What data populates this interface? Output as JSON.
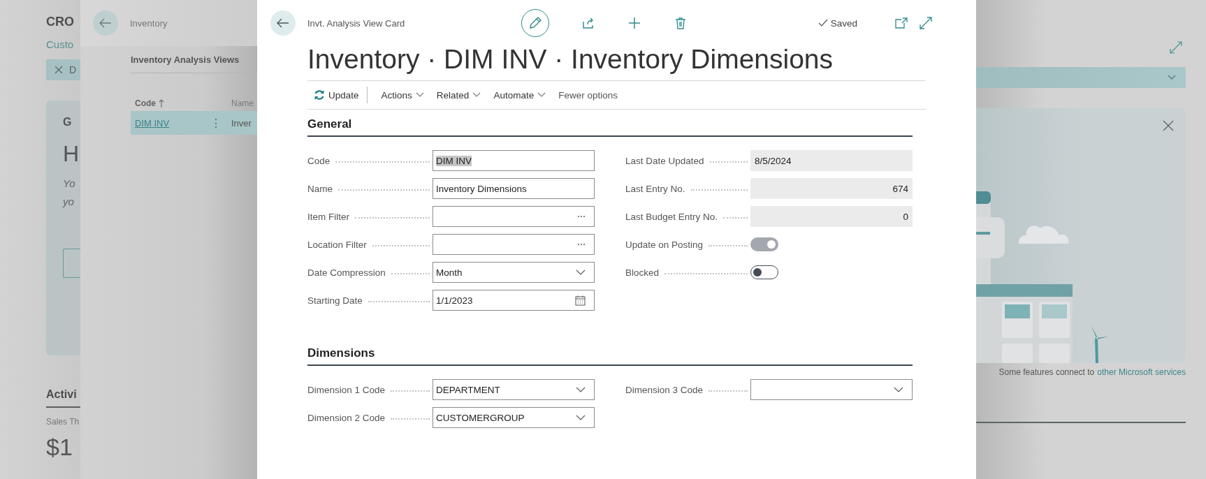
{
  "background_page": {
    "title": "CRO",
    "link": "Custo",
    "filter_chip": {
      "label": "D"
    },
    "card": {
      "heading": "G",
      "big_text": "H",
      "lines": [
        "Yo",
        "yo"
      ]
    },
    "section_title": "Activi",
    "caption": "Sales Th",
    "amount": "$1",
    "footer": {
      "text": "Some features connect to",
      "link": "other Microsoft services"
    }
  },
  "list_page": {
    "breadcrumb": "Inventory",
    "tab": "Inventory Analysis Views",
    "columns": [
      {
        "label": "Code",
        "sorted": true
      },
      {
        "label": "Name",
        "sorted": false
      }
    ],
    "rows": [
      {
        "code": "DIM INV",
        "menu": "⋮",
        "name": "Inver",
        "selected": true
      }
    ]
  },
  "card": {
    "breadcrumb": "Invt. Analysis View Card",
    "status": "Saved",
    "title": "Inventory · DIM INV · Inventory Dimensions",
    "actions": [
      {
        "label": "Update",
        "kind": "refresh"
      },
      {
        "label": "Actions",
        "kind": "menu"
      },
      {
        "label": "Related",
        "kind": "menu"
      },
      {
        "label": "Automate",
        "kind": "menu"
      },
      {
        "label": "Fewer options",
        "kind": "plain"
      }
    ],
    "sections": [
      {
        "title": "General",
        "columns": [
          [
            {
              "label": "Code",
              "kind": "text",
              "value": "DIM INV",
              "text_selected": true
            },
            {
              "label": "Name",
              "kind": "text",
              "value": "Inventory Dimensions",
              "text_selected": false
            },
            {
              "label": "Item Filter",
              "kind": "lookup"
            },
            {
              "label": "Location Filter",
              "kind": "lookup"
            },
            {
              "label": "Date Compression",
              "kind": "select",
              "value": "Month"
            },
            {
              "label": "Starting Date",
              "kind": "date",
              "value": "1/1/2023"
            }
          ],
          [
            {
              "label": "Last Date Updated",
              "kind": "readonly",
              "value": "8/5/2024"
            },
            {
              "label": "Last Entry No.",
              "kind": "readonly_number",
              "value": "674"
            },
            {
              "label": "Last Budget Entry No.",
              "kind": "readonly_number",
              "value": "0"
            },
            {
              "label": "Update on Posting",
              "kind": "toggle",
              "on": true
            },
            {
              "label": "Blocked",
              "kind": "toggle",
              "on": false
            }
          ]
        ]
      },
      {
        "title": "Dimensions",
        "columns": [
          [
            {
              "label": "Dimension 1 Code",
              "kind": "select",
              "value": "DEPARTMENT"
            },
            {
              "label": "Dimension 2 Code",
              "kind": "select",
              "value": "CUSTOMERGROUP"
            }
          ],
          [
            {
              "label": "Dimension 3 Code",
              "kind": "select"
            }
          ]
        ]
      }
    ]
  }
}
